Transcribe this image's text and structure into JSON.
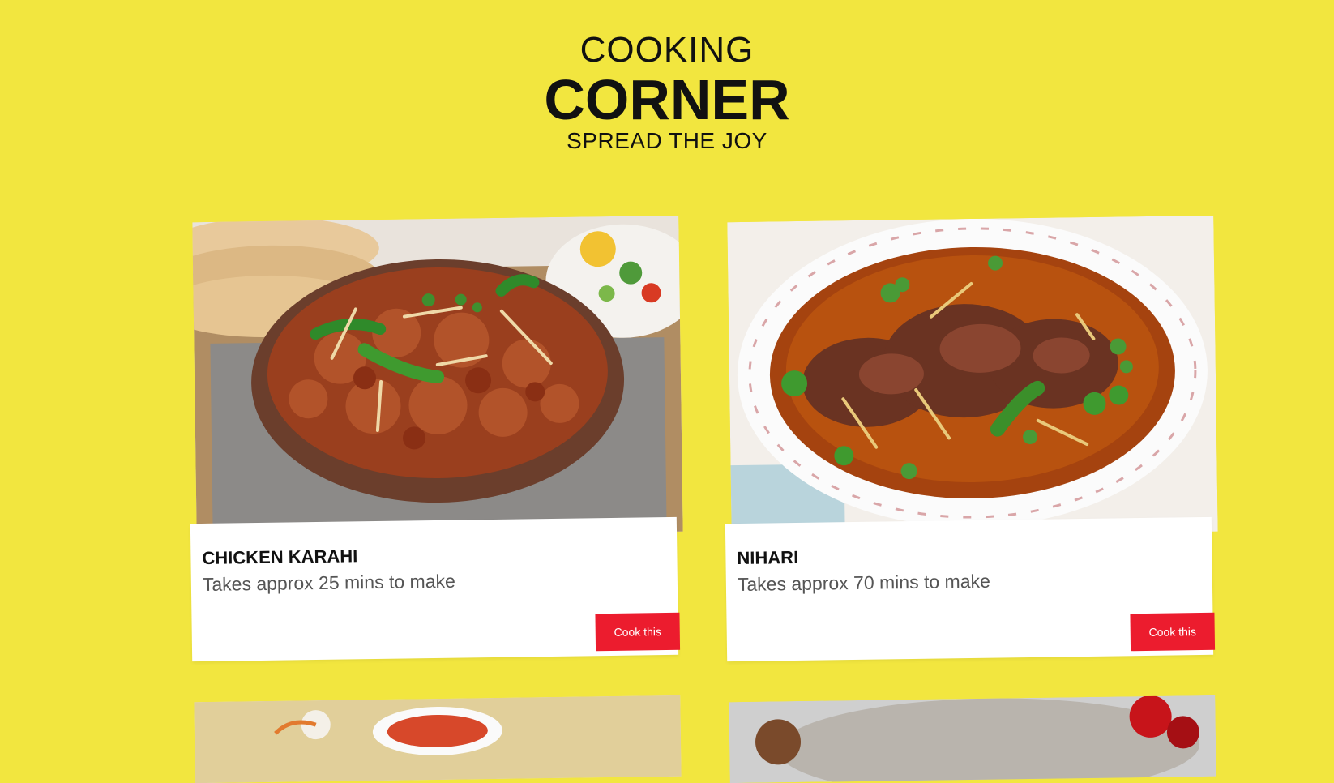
{
  "header": {
    "line1": "COOKING",
    "line2": "CORNER",
    "line3": "SPREAD THE JOY"
  },
  "recipes": [
    {
      "name": "CHICKEN KARAHI",
      "description": "Takes approx 25 mins to make",
      "button_label": "Cook this"
    },
    {
      "name": "NIHARI",
      "description": "Takes approx 70 mins to make",
      "button_label": "Cook this"
    }
  ],
  "colors": {
    "background": "#f2e63f",
    "button": "#ec1c2e",
    "card": "#ffffff"
  }
}
